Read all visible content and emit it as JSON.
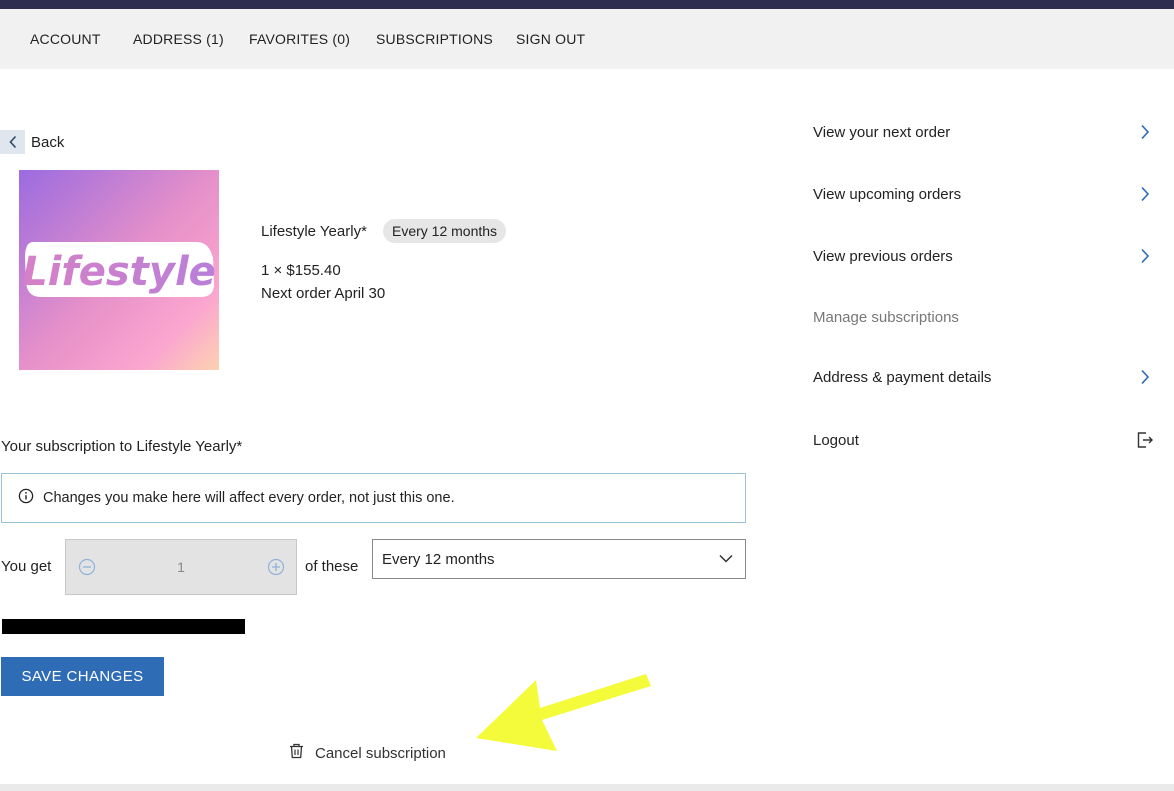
{
  "nav": {
    "items": [
      {
        "label": "ACCOUNT"
      },
      {
        "label": "ADDRESS (1)"
      },
      {
        "label": "FAVORITES (0)"
      },
      {
        "label": "SUBSCRIPTIONS"
      },
      {
        "label": "SIGN OUT"
      }
    ]
  },
  "back": {
    "label": "Back",
    "icon": "chevron-left-icon"
  },
  "product": {
    "logo_text": "Lifestyle",
    "name": "Lifestyle Yearly*",
    "frequency_badge": "Every 12 months",
    "quantity_price": "1 × $155.40",
    "next_order": "Next order April 30"
  },
  "sidebar": {
    "items": [
      {
        "label": "View your next order",
        "icon": "chevron-right-icon"
      },
      {
        "label": "View upcoming orders",
        "icon": "chevron-right-icon"
      },
      {
        "label": "View previous orders",
        "icon": "chevron-right-icon"
      },
      {
        "label": "Manage subscriptions",
        "icon": ""
      },
      {
        "label": "Address & payment details",
        "icon": "chevron-right-icon"
      },
      {
        "label": "Logout",
        "icon": "logout-icon"
      }
    ]
  },
  "subscription": {
    "heading": "Your subscription to Lifestyle Yearly*",
    "notice": "Changes you make here will affect every order, not just this one.",
    "you_get_label": "You get",
    "quantity": "1",
    "of_these_label": "of these",
    "frequency_value": "Every 12 months"
  },
  "actions": {
    "save_label": "SAVE CHANGES",
    "cancel_label": "Cancel subscription"
  },
  "colors": {
    "accent": "#2e6db6",
    "topbar": "#2f2d4f",
    "nav_bg": "#f1f1f1",
    "annotation_arrow": "#f3fb3a"
  }
}
